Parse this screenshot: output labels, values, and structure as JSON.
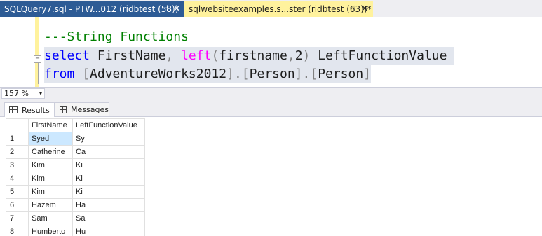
{
  "tabs": [
    {
      "title": "SQLQuery7.sql - PTW...012 (ridbtest (58))",
      "pin": "⊣",
      "close": "✕"
    },
    {
      "title": "sqlwebsiteexamples.s...ster (ridbtest (63))*",
      "pin": "⊣",
      "close": "✕"
    }
  ],
  "editor": {
    "line1": "---String Functions",
    "line2": {
      "kw1": "select",
      "t1": " FirstName",
      "p1": ",",
      "sp": " ",
      "fn": "left",
      "p2": "(",
      "t2": "firstname",
      "p3": ",",
      "t3": "2",
      "p4": ")",
      "t4": " LeftFunctionValue"
    },
    "line3": {
      "kw1": "from",
      "sp": " ",
      "p1": "[",
      "t1": "AdventureWorks2012",
      "p2": "].[",
      "t2": "Person",
      "p3": "].[",
      "t3": "Person",
      "p4": "]"
    },
    "collapse": "−"
  },
  "zoom": {
    "value": "157 %",
    "arrow": "▾"
  },
  "result_tabs": {
    "results": "Results",
    "messages": "Messages"
  },
  "grid": {
    "columns": [
      "FirstName",
      "LeftFunctionValue"
    ],
    "rows": [
      {
        "n": "1",
        "first": "Syed",
        "left": "Sy"
      },
      {
        "n": "2",
        "first": "Catherine",
        "left": "Ca"
      },
      {
        "n": "3",
        "first": "Kim",
        "left": "Ki"
      },
      {
        "n": "4",
        "first": "Kim",
        "left": "Ki"
      },
      {
        "n": "5",
        "first": "Kim",
        "left": "Ki"
      },
      {
        "n": "6",
        "first": "Hazem",
        "left": "Ha"
      },
      {
        "n": "7",
        "first": "Sam",
        "left": "Sa"
      },
      {
        "n": "8",
        "first": "Humberto",
        "left": "Hu"
      }
    ]
  },
  "colors": {
    "tab_active": "#fff29d",
    "tab_inactive": "#2d5b95",
    "keyword": "#0000ff",
    "function": "#ff00ff",
    "comment": "#008000",
    "selection": "#cce8ff"
  }
}
